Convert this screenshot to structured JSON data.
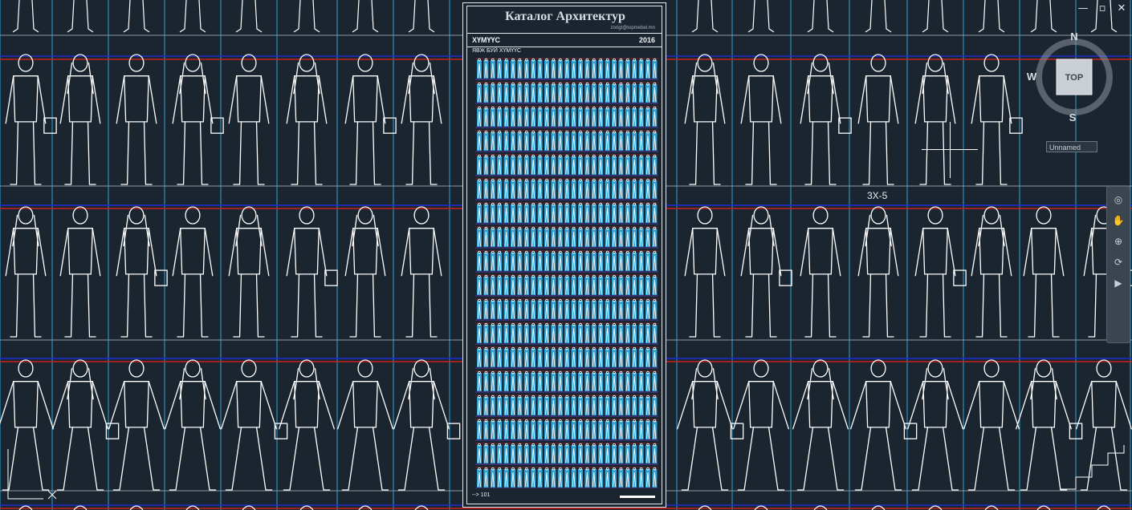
{
  "window": {
    "minimize": "—",
    "restore": "▫",
    "close": "✕"
  },
  "catalog": {
    "title": "Каталог Архитектур",
    "email": "zorigt@topmebel.mn",
    "category": "ХҮМҮҮС",
    "year": "2016",
    "subtitle": "ЯВЖ БУЙ ХҮМҮҮС",
    "footer": "--> 101"
  },
  "viewcube": {
    "north": "N",
    "south": "S",
    "west": "W",
    "face": "TOP",
    "ucs_name": "Unnamed"
  },
  "coordinate_label": "3X-5",
  "colors": {
    "background": "#1b2530",
    "grid": "#2fa3d6",
    "rule_red": "#c8201e",
    "rule_blue": "#1c2fd0",
    "linework": "#ffffff"
  },
  "navbar": {
    "tools": [
      "steering-wheel-icon",
      "pan-icon",
      "zoom-icon",
      "orbit-icon",
      "showmotion-icon"
    ]
  }
}
